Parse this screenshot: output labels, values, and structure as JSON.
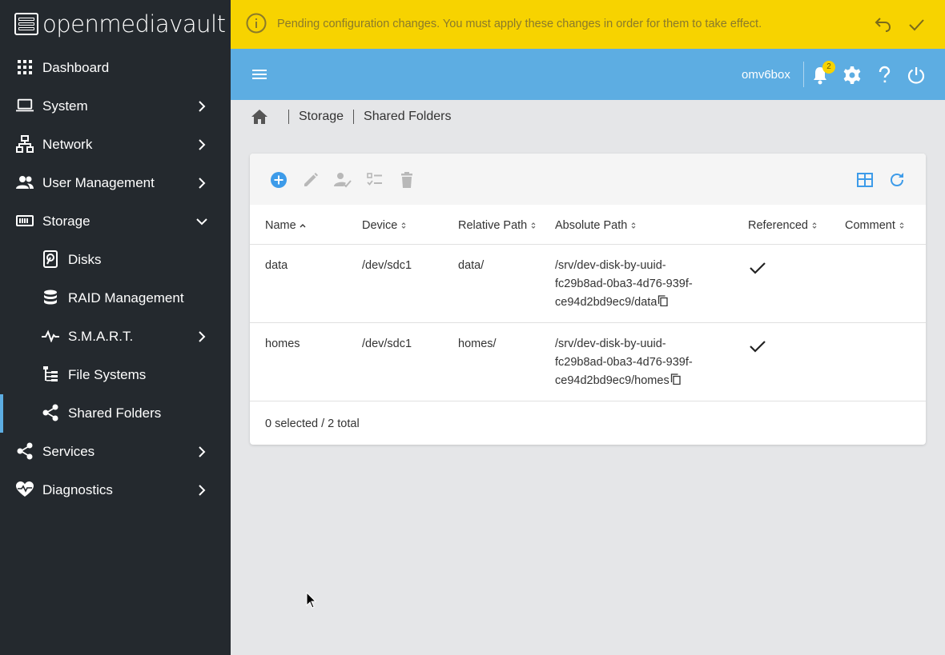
{
  "brand": {
    "name": "openmediavault"
  },
  "sidebar": {
    "items": [
      {
        "label": "Dashboard",
        "icon": "dashboard-grid-icon"
      },
      {
        "label": "System",
        "icon": "laptop-icon"
      },
      {
        "label": "Network",
        "icon": "network-icon"
      },
      {
        "label": "User Management",
        "icon": "users-icon"
      },
      {
        "label": "Storage",
        "icon": "storage-icon"
      },
      {
        "label": "Disks",
        "icon": "disk-icon"
      },
      {
        "label": "RAID Management",
        "icon": "database-icon"
      },
      {
        "label": "S.M.A.R.T.",
        "icon": "pulse-icon"
      },
      {
        "label": "File Systems",
        "icon": "file-tree-icon"
      },
      {
        "label": "Shared Folders",
        "icon": "share-icon"
      },
      {
        "label": "Services",
        "icon": "share-icon"
      },
      {
        "label": "Diagnostics",
        "icon": "heart-pulse-icon"
      }
    ]
  },
  "pending": {
    "message": "Pending configuration changes. You must apply these changes in order for them to take effect.",
    "background": "#f7d300"
  },
  "topbar": {
    "hostname": "omv6box",
    "notification_count": "2",
    "background": "#5dade2"
  },
  "breadcrumb": {
    "items": [
      "Storage",
      "Shared Folders"
    ]
  },
  "table": {
    "columns": [
      "Name",
      "Device",
      "Relative Path",
      "Absolute Path",
      "Referenced",
      "Comment"
    ],
    "rows": [
      {
        "name": "data",
        "device": "/dev/sdc1",
        "relative_path": "data/",
        "absolute_path_line1": "/srv/dev-disk-by-uuid-",
        "absolute_path_line2": "fc29b8ad-0ba3-4d76-939f-",
        "absolute_path_line3": "ce94d2bd9ec9/data",
        "referenced": true,
        "comment": ""
      },
      {
        "name": "homes",
        "device": "/dev/sdc1",
        "relative_path": "homes/",
        "absolute_path_line1": "/srv/dev-disk-by-uuid-",
        "absolute_path_line2": "fc29b8ad-0ba3-4d76-939f-",
        "absolute_path_line3": "ce94d2bd9ec9/homes",
        "referenced": true,
        "comment": ""
      }
    ],
    "footer": "0 selected / 2 total"
  },
  "colors": {
    "sidebar": "#24292e",
    "accent": "#5dade2",
    "warning": "#f7d300"
  }
}
